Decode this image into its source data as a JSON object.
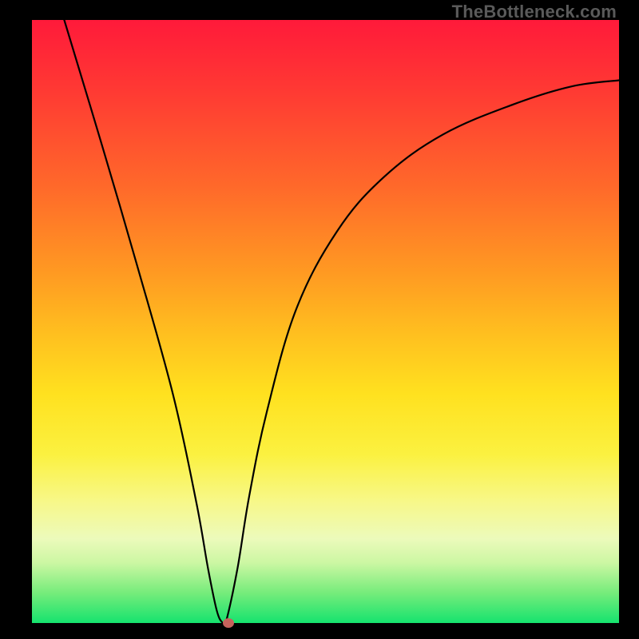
{
  "watermark": "TheBottleneck.com",
  "chart_data": {
    "type": "line",
    "title": "",
    "xlabel": "",
    "ylabel": "",
    "xlim": [
      0,
      100
    ],
    "ylim": [
      0,
      100
    ],
    "gradient_stops": [
      {
        "pos": 0,
        "color": "#ff1a3a"
      },
      {
        "pos": 12,
        "color": "#ff3a33"
      },
      {
        "pos": 28,
        "color": "#ff6a2a"
      },
      {
        "pos": 42,
        "color": "#ff9a22"
      },
      {
        "pos": 52,
        "color": "#ffbf1f"
      },
      {
        "pos": 62,
        "color": "#ffe11f"
      },
      {
        "pos": 72,
        "color": "#fbf140"
      },
      {
        "pos": 80,
        "color": "#f7f88a"
      },
      {
        "pos": 86,
        "color": "#ecfabb"
      },
      {
        "pos": 90,
        "color": "#ccf7a3"
      },
      {
        "pos": 95,
        "color": "#76ec7b"
      },
      {
        "pos": 100,
        "color": "#15e36e"
      }
    ],
    "series": [
      {
        "name": "bottleneck-curve",
        "x": [
          5.5,
          12,
          18,
          24,
          28,
          30,
          31.5,
          32.5,
          33,
          35,
          37,
          40,
          45,
          52,
          60,
          70,
          82,
          92,
          100
        ],
        "values": [
          100,
          79,
          59,
          38,
          20,
          9,
          2,
          0,
          0,
          9,
          21,
          35,
          52,
          65,
          74,
          81,
          86,
          89,
          90
        ]
      }
    ],
    "flat_segment": {
      "x0": 31.5,
      "x1": 33,
      "y": 0
    },
    "marker": {
      "x": 33.5,
      "y": 0,
      "color": "#c6625c"
    }
  }
}
